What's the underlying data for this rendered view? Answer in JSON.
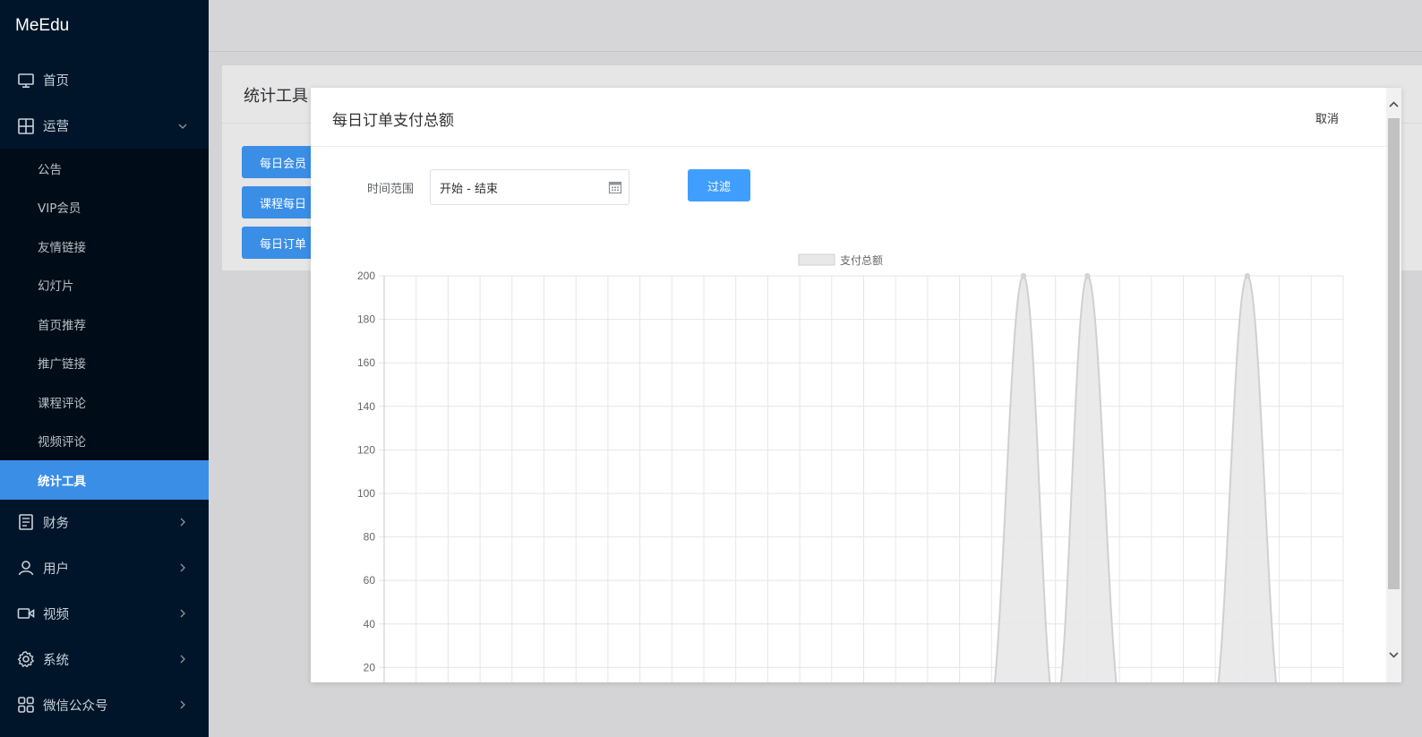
{
  "app": {
    "logo": "MeEdu"
  },
  "sidebar": {
    "items": [
      {
        "label": "首页",
        "icon": "monitor-icon"
      },
      {
        "label": "运营",
        "icon": "grid-icon",
        "expanded": true,
        "children": [
          "公告",
          "VIP会员",
          "友情链接",
          "幻灯片",
          "首页推荐",
          "推广链接",
          "课程评论",
          "视频评论",
          "统计工具"
        ],
        "active_child": "统计工具"
      },
      {
        "label": "财务",
        "icon": "document-icon"
      },
      {
        "label": "用户",
        "icon": "user-icon"
      },
      {
        "label": "视频",
        "icon": "video-icon"
      },
      {
        "label": "系统",
        "icon": "gear-icon"
      },
      {
        "label": "微信公众号",
        "icon": "apps-icon"
      }
    ]
  },
  "page": {
    "title": "统计工具",
    "buttons": [
      "每日会员",
      "课程每日",
      "每日订单"
    ]
  },
  "modal": {
    "title": "每日订单支付总额",
    "cancel_label": "取消",
    "filter": {
      "label": "时间范围",
      "value": "开始 - 结束",
      "button_label": "过滤"
    }
  },
  "colors": {
    "sidebar_bg": "#001529",
    "submenu_bg": "#000c17",
    "accent": "#3a8ee6",
    "filter_button": "#409eff",
    "series_fill": "#e8e8e8",
    "series_stroke": "#d0d0d0"
  },
  "chart_data": {
    "type": "area",
    "legend": [
      "支付总额"
    ],
    "legend_position": "top-center",
    "grid": true,
    "ylim": [
      0,
      200
    ],
    "yticks": [
      20,
      40,
      60,
      80,
      100,
      120,
      140,
      160,
      180,
      200
    ],
    "series": [
      {
        "name": "支付总额",
        "values": [
          0,
          0,
          0,
          0,
          0,
          0,
          0,
          0,
          0,
          0,
          0,
          0,
          0,
          0,
          0,
          0,
          0,
          0,
          0,
          0,
          200,
          0,
          200,
          0,
          0,
          0,
          0,
          200,
          0,
          0,
          0
        ]
      }
    ]
  }
}
